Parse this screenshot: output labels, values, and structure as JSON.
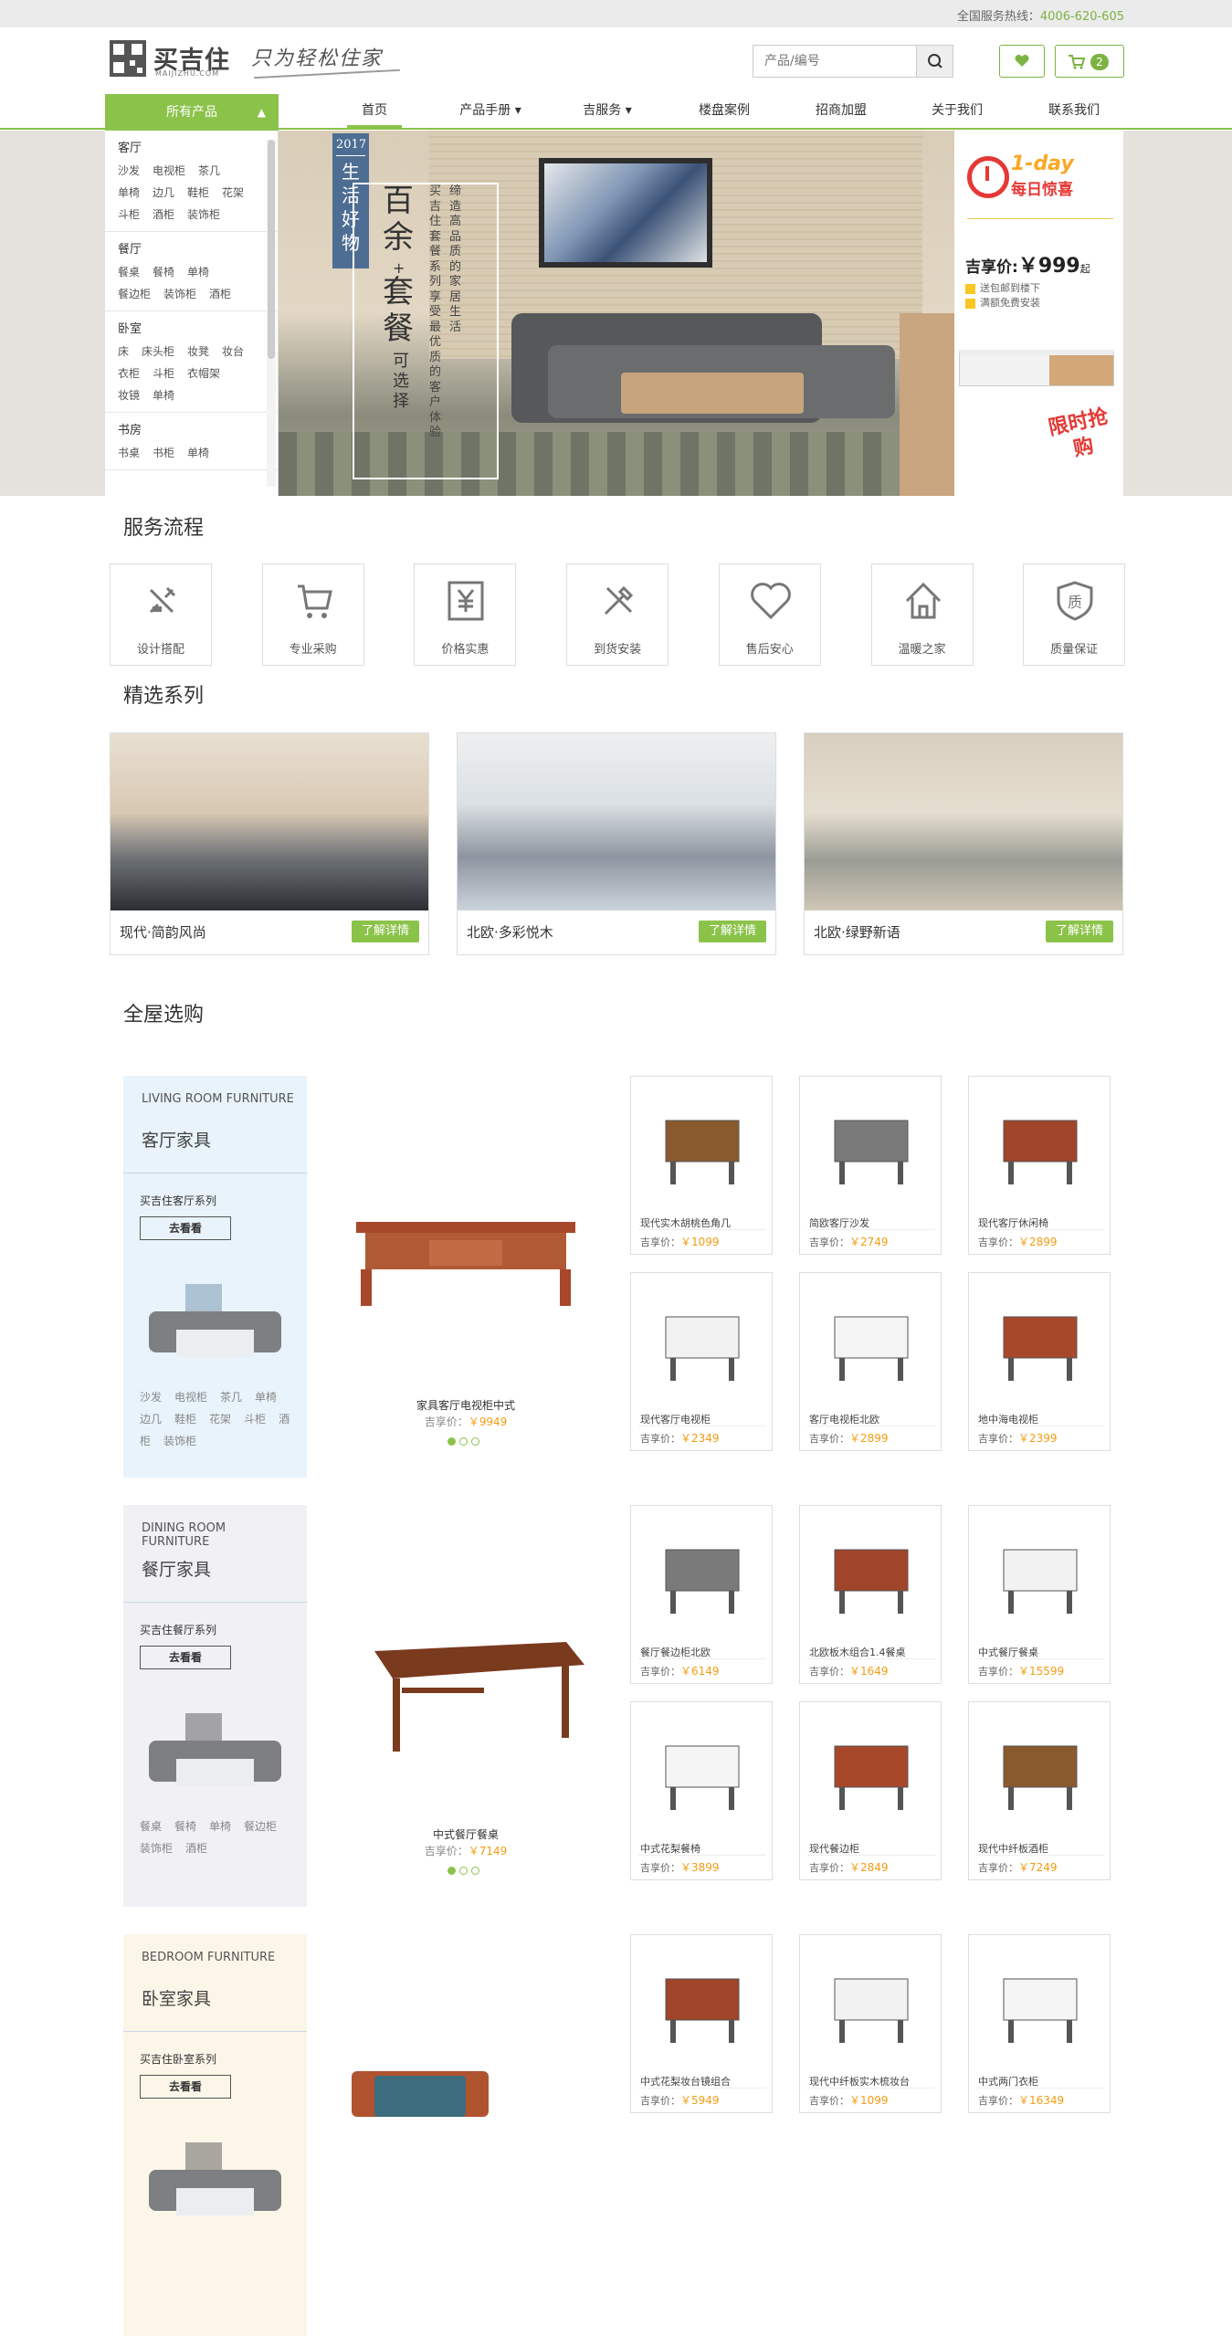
{
  "topbar": {
    "hotline_label": "全国服务热线：",
    "hotline": "4006-620-605"
  },
  "logo": {
    "name": "买吉住",
    "sub": "MAIJIZHU.COM",
    "slogan": "只为轻松住家"
  },
  "search": {
    "placeholder": "产品/编号"
  },
  "cart": {
    "count": "2"
  },
  "nav": {
    "all_products": "所有产品",
    "items": [
      "首页",
      "产品手册 ▾",
      "吉服务 ▾",
      "楼盘案例",
      "招商加盟",
      "关于我们",
      "联系我们"
    ]
  },
  "catmenu": [
    {
      "title": "客厅",
      "items": [
        "沙发",
        "电视柜",
        "茶几",
        "单椅",
        "边几",
        "鞋柜",
        "花架",
        "斗柜",
        "酒柜",
        "装饰柜"
      ]
    },
    {
      "title": "餐厅",
      "items": [
        "餐桌",
        "餐椅",
        "单椅",
        "餐边柜",
        "装饰柜",
        "酒柜"
      ]
    },
    {
      "title": "卧室",
      "items": [
        "床",
        "床头柜",
        "妆凳",
        "妆台",
        "衣柜",
        "斗柜",
        "衣帽架",
        "妆镜",
        "单椅"
      ]
    },
    {
      "title": "书房",
      "items": [
        "书桌",
        "书柜",
        "单椅"
      ]
    }
  ],
  "banner": {
    "year": "2017",
    "vlabel": "生活好物",
    "headline1": "百余",
    "plus": "+",
    "headline2": "套餐",
    "option": "可选择",
    "desc1": "缔造高品质的家居生活",
    "desc2": "买吉住套餐系列享受最优质的客户体验"
  },
  "promo": {
    "oneday": "1-day",
    "daily": "每日惊喜",
    "price_label": "吉享价:",
    "price": "￥999",
    "price_unit": "起",
    "feat1": "送包邮到楼下",
    "feat2": "满额免费安装",
    "stamp": "限时抢购"
  },
  "service": {
    "title": "服务流程",
    "items": [
      {
        "label": "设计搭配",
        "icon": "design-icon"
      },
      {
        "label": "专业采购",
        "icon": "cart-icon"
      },
      {
        "label": "价格实惠",
        "icon": "yen-icon"
      },
      {
        "label": "到货安装",
        "icon": "tools-icon"
      },
      {
        "label": "售后安心",
        "icon": "heart-icon"
      },
      {
        "label": "温暖之家",
        "icon": "home-icon"
      },
      {
        "label": "质量保证",
        "icon": "shield-icon"
      }
    ]
  },
  "series": {
    "title": "精选系列",
    "detail": "了解详情",
    "items": [
      "现代·简韵风尚",
      "北欧·多彩悦木",
      "北欧·绿野新语"
    ]
  },
  "whole": {
    "title": "全屋选购"
  },
  "sections": [
    {
      "en": "LIVING ROOM FURNITURE",
      "zh": "客厅家具",
      "series": "买吉住客厅系列",
      "go": "去看看",
      "tags": [
        "沙发",
        "电视柜",
        "茶几",
        "单椅",
        "边几",
        "鞋柜",
        "花架",
        "斗柜",
        "酒柜",
        "装饰柜"
      ],
      "feature": {
        "name": "家具客厅电视柜中式",
        "price_label": "吉享价：",
        "price": "￥9949"
      },
      "products": [
        {
          "name": "现代实木胡桃色角几",
          "price": "￥1099"
        },
        {
          "name": "简欧客厅沙发",
          "price": "￥2749"
        },
        {
          "name": "现代客厅休闲椅",
          "price": "￥2899"
        },
        {
          "name": "现代客厅电视柜",
          "price": "￥2349"
        },
        {
          "name": "客厅电视柜北欧",
          "price": "￥2899"
        },
        {
          "name": "地中海电视柜",
          "price": "￥2399"
        }
      ]
    },
    {
      "en": "DINING ROOM FURNITURE",
      "zh": "餐厅家具",
      "series": "买吉住餐厅系列",
      "go": "去看看",
      "tags": [
        "餐桌",
        "餐椅",
        "单椅",
        "餐边柜",
        "装饰柜",
        "酒柜"
      ],
      "feature": {
        "name": "中式餐厅餐桌",
        "price_label": "吉享价：",
        "price": "￥7149"
      },
      "products": [
        {
          "name": "餐厅餐边柜北欧",
          "price": "￥6149"
        },
        {
          "name": "北欧板木组合1.4餐桌",
          "price": "￥1649"
        },
        {
          "name": "中式餐厅餐桌",
          "price": "￥15599"
        },
        {
          "name": "中式花梨餐椅",
          "price": "￥3899"
        },
        {
          "name": "现代餐边柜",
          "price": "￥2849"
        },
        {
          "name": "现代中纤板酒柜",
          "price": "￥7249"
        }
      ]
    },
    {
      "en": "BEDROOM FURNITURE",
      "zh": "卧室家具",
      "series": "买吉住卧室系列",
      "go": "去看看",
      "tags": [],
      "feature": {
        "name": "",
        "price_label": "",
        "price": ""
      },
      "products": [
        {
          "name": "中式花梨妆台镜组合",
          "price": "￥5949"
        },
        {
          "name": "现代中纤板实木梳妆台",
          "price": "￥1099"
        },
        {
          "name": "中式两门衣柜",
          "price": "￥16349"
        }
      ]
    }
  ],
  "price_prefix": "吉享价：",
  "colors": {
    "accent": "#8bc34a",
    "price": "#f39c12",
    "promo_red": "#e53935"
  }
}
